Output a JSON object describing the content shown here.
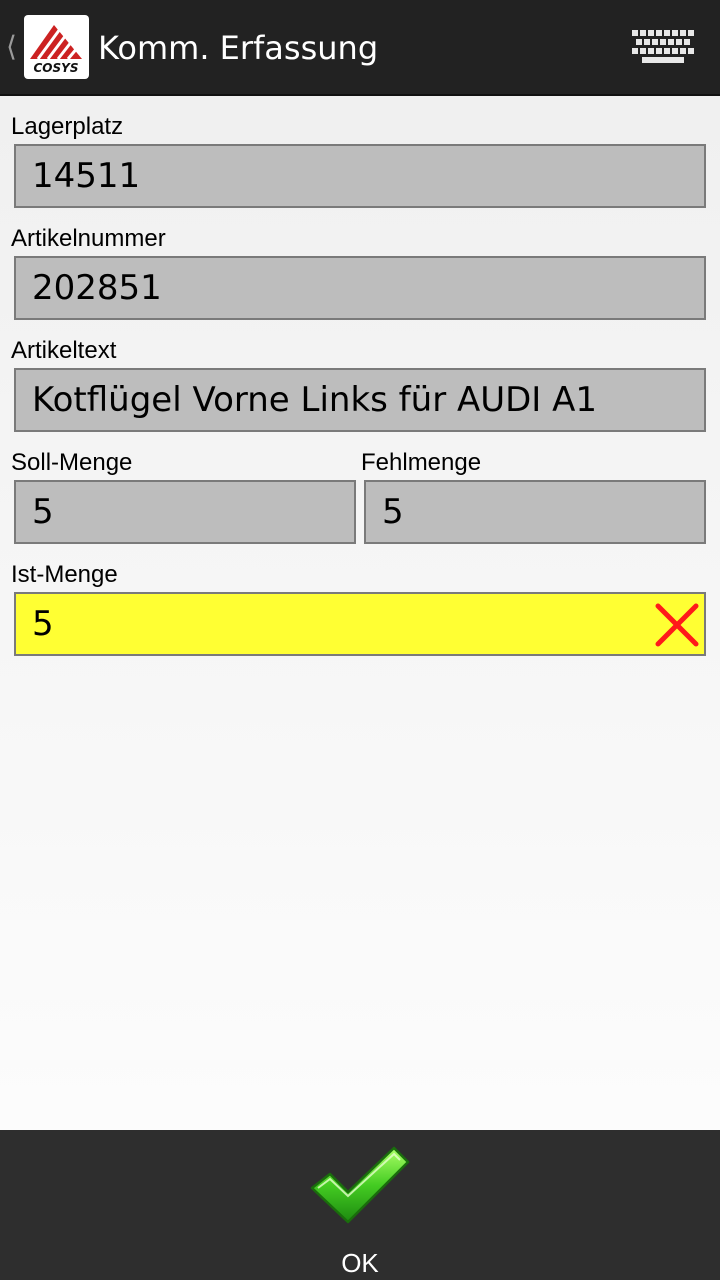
{
  "header": {
    "up_icon": "chevron-left-icon",
    "logo_icon": "app-logo-icon",
    "logo_text": "COSYS",
    "title": "Komm. Erfassung",
    "keyboard_icon": "keyboard-icon"
  },
  "form": {
    "lagerplatz": {
      "label": "Lagerplatz",
      "value": "14511"
    },
    "artikelnummer": {
      "label": "Artikelnummer",
      "value": "202851"
    },
    "artikeltext": {
      "label": "Artikeltext",
      "value": "Kotflügel Vorne Links für AUDI A1"
    },
    "soll_menge": {
      "label": "Soll-Menge",
      "value": "5"
    },
    "fehlmenge": {
      "label": "Fehlmenge",
      "value": "5"
    },
    "ist_menge": {
      "label": "Ist-Menge",
      "value": "5",
      "clear_icon": "close-icon"
    }
  },
  "footer": {
    "ok_label": "OK",
    "ok_icon": "checkmark-icon"
  },
  "colors": {
    "action_bar": "#222222",
    "field_bg": "#bdbdbd",
    "active_field_bg": "#ffff33",
    "clear_red": "#ff1a1a",
    "ok_green": "#44cc22"
  }
}
